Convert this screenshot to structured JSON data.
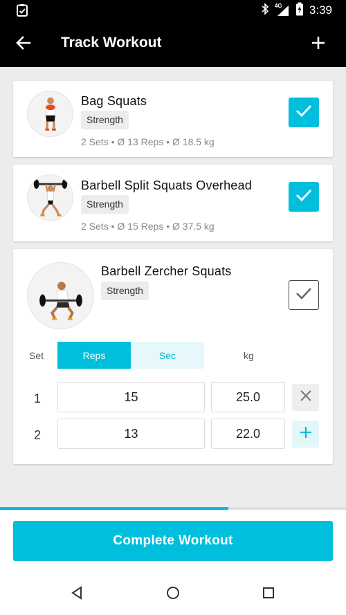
{
  "status_bar": {
    "time": "3:39",
    "network": "4G",
    "icons": [
      "clipboard-check-icon",
      "bluetooth-icon",
      "signal-icon",
      "battery-charging-icon"
    ]
  },
  "app_bar": {
    "title": "Track Workout",
    "back_icon": "arrow-left-icon",
    "add_icon": "plus-icon"
  },
  "accent_color": "#00bfdc",
  "exercises": [
    {
      "name": "Bag Squats",
      "category": "Strength",
      "sets": "2 Sets",
      "reps": "Ø 13 Reps",
      "weight": "Ø 18.5 kg",
      "completed": true
    },
    {
      "name": "Barbell Split Squats Overhead",
      "category": "Strength",
      "sets": "2 Sets",
      "reps": "Ø 15 Reps",
      "weight": "Ø 37.5 kg",
      "completed": true
    },
    {
      "name": "Barbell Zercher Squats",
      "category": "Strength",
      "completed": false
    }
  ],
  "set_table": {
    "set_label": "Set",
    "modes": [
      "Reps",
      "Sec"
    ],
    "active_mode": "Reps",
    "weight_label": "kg",
    "rows": [
      {
        "set": "1",
        "reps": "15",
        "kg": "25.0",
        "action": "remove"
      },
      {
        "set": "2",
        "reps": "13",
        "kg": "22.0",
        "action": "add"
      }
    ]
  },
  "progress": 0.66,
  "complete_button": "Complete Workout",
  "nav": [
    "back",
    "home",
    "recents"
  ]
}
